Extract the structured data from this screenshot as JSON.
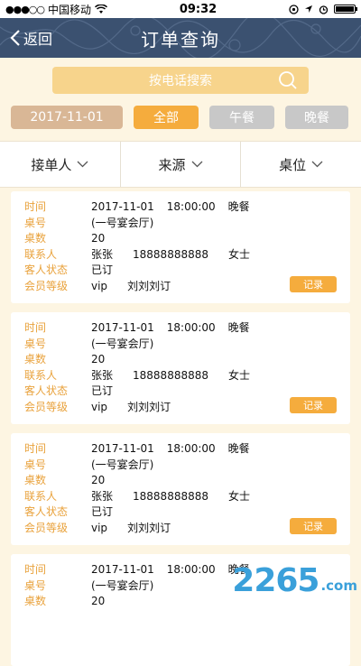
{
  "status_bar": {
    "signal": "●●●○○",
    "carrier": "中国移动",
    "time": "09:32"
  },
  "navbar": {
    "back_label": "返回",
    "title": "订单查询"
  },
  "search": {
    "placeholder": "按电话搜索"
  },
  "filters": {
    "date": "2017-11-01",
    "all": "全部",
    "lunch": "午餐",
    "dinner": "晚餐"
  },
  "dropdowns": [
    {
      "label": "接单人"
    },
    {
      "label": "来源"
    },
    {
      "label": "桌位"
    }
  ],
  "labels": {
    "time": "时间",
    "table_no": "桌号",
    "table_count": "桌数",
    "contact": "联系人",
    "guest_status": "客人状态",
    "member_level": "会员等级",
    "record_btn": "记录"
  },
  "orders": [
    {
      "date": "2017-11-01",
      "clock": "18:00:00",
      "meal": "晚餐",
      "table": "(一号宴会厅)",
      "count": "20",
      "contact": "张张",
      "phone": "18888888888",
      "title": "女士",
      "status": "已订",
      "level": "vip",
      "booker": "刘刘刘订"
    },
    {
      "date": "2017-11-01",
      "clock": "18:00:00",
      "meal": "晚餐",
      "table": "(一号宴会厅)",
      "count": "20",
      "contact": "张张",
      "phone": "18888888888",
      "title": "女士",
      "status": "已订",
      "level": "vip",
      "booker": "刘刘刘订"
    },
    {
      "date": "2017-11-01",
      "clock": "18:00:00",
      "meal": "晚餐",
      "table": "(一号宴会厅)",
      "count": "20",
      "contact": "张张",
      "phone": "18888888888",
      "title": "女士",
      "status": "已订",
      "level": "vip",
      "booker": "刘刘刘订"
    },
    {
      "date": "2017-11-01",
      "clock": "18:00:00",
      "meal": "晚餐",
      "table": "(一号宴会厅)",
      "count": "20",
      "contact": "",
      "phone": "",
      "title": "",
      "status": "",
      "level": "",
      "booker": ""
    }
  ],
  "watermark": {
    "big": "2265",
    "small": ".com"
  }
}
